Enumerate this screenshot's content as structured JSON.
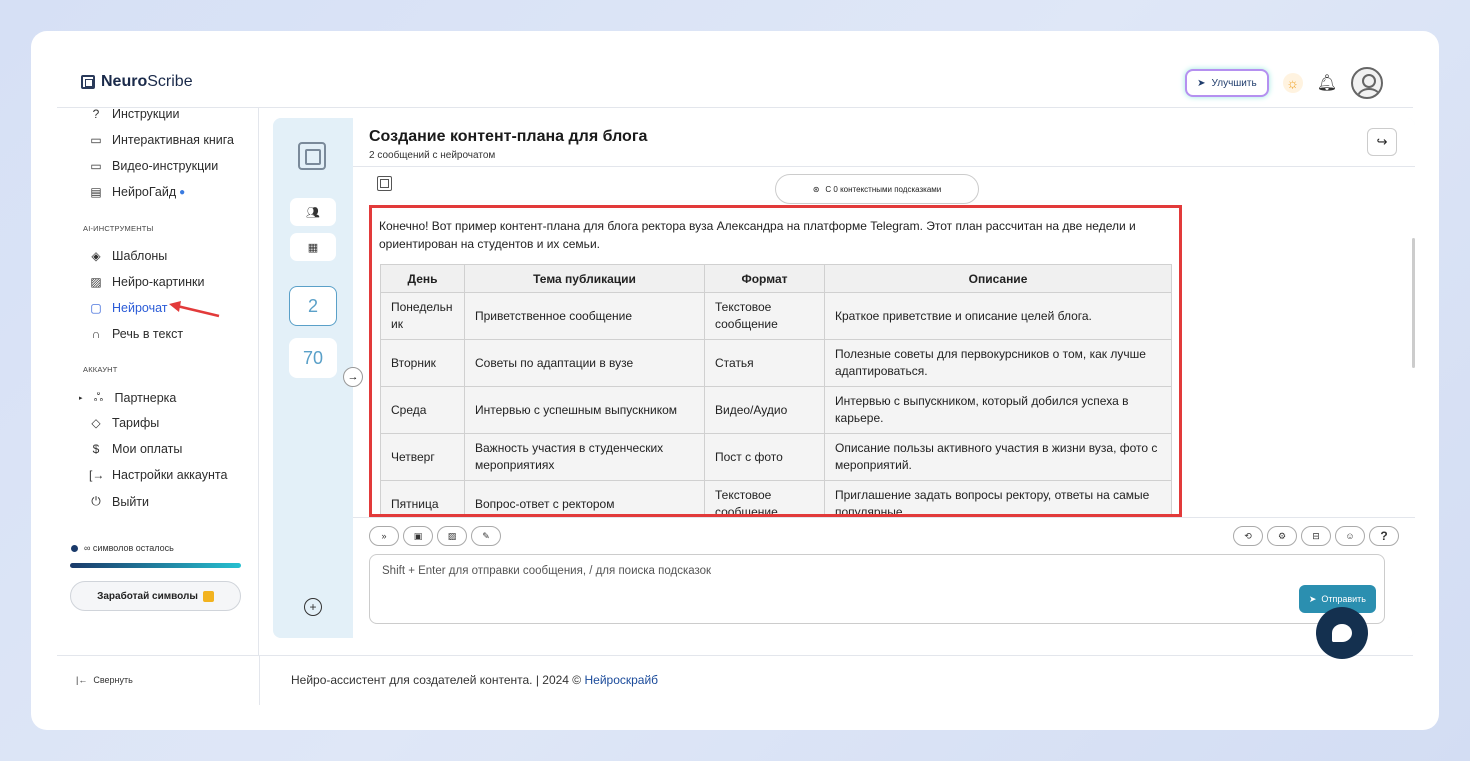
{
  "app": {
    "logo_bold": "Neuro",
    "logo_rest": "Scribe"
  },
  "topbar": {
    "upgrade_label": "Улучшить"
  },
  "sidebar": {
    "items_top": [
      {
        "label": "Инструкции"
      },
      {
        "label": "Интерактивная книга"
      },
      {
        "label": "Видео-инструкции"
      },
      {
        "label": "НейроГайд"
      }
    ],
    "section_ai": "AI-ИНСТРУМЕНТЫ",
    "items_ai": [
      {
        "label": "Шаблоны"
      },
      {
        "label": "Нейро-картинки"
      },
      {
        "label": "Нейрочат"
      },
      {
        "label": "Речь в текст"
      }
    ],
    "section_account": "АККАУНТ",
    "items_account": [
      {
        "label": "Партнерка"
      },
      {
        "label": "Тарифы"
      },
      {
        "label": "Мои оплаты"
      },
      {
        "label": "Настройки аккаунта"
      },
      {
        "label": "Выйти"
      }
    ],
    "symbols_text": "∞ символов осталось",
    "earn_button": "Заработай символы",
    "collapse_label": "Свернуть"
  },
  "rail": {
    "count_selected": "2",
    "count_other": "70"
  },
  "chat": {
    "title": "Создание контент-плана для блога",
    "subtitle": "2 сообщений с нейрочатом",
    "context_pill": "С 0 контекстными подсказками",
    "intro": "Конечно! Вот пример контент-плана для блога ректора вуза Александра на платформе Telegram. Этот план рассчитан на две недели и ориентирован на студентов и их семьи.",
    "table": {
      "headers": [
        "День",
        "Тема публикации",
        "Формат",
        "Описание"
      ],
      "rows": [
        [
          "Понедельник",
          "Приветственное сообщение",
          "Текстовое сообщение",
          "Краткое приветствие и описание целей блога."
        ],
        [
          "Вторник",
          "Советы по адаптации в вузе",
          "Статья",
          "Полезные советы для первокурсников о том, как лучше адаптироваться."
        ],
        [
          "Среда",
          "Интервью с успешным выпускником",
          "Видео/Аудио",
          "Интервью с выпускником, который добился успеха в карьере."
        ],
        [
          "Четверг",
          "Важность участия в студенческих мероприятиях",
          "Пост с фото",
          "Описание пользы активного участия в жизни вуза, фото с мероприятий."
        ],
        [
          "Пятница",
          "Вопрос-ответ с ректором",
          "Текстовое сообщение",
          "Приглашение задать вопросы ректору, ответы на самые популярные."
        ]
      ]
    },
    "input_placeholder": "Shift + Enter для отправки сообщения, / для поиска подсказок",
    "send_label": "Отправить"
  },
  "footer": {
    "text": "Нейро-ассистент для создателей контента.  | 2024 © ",
    "link": "Нейроскрайб"
  },
  "colors": {
    "accent": "#2b8fb0",
    "highlight_border": "#e23a3a",
    "brand_dark": "#14304f"
  }
}
